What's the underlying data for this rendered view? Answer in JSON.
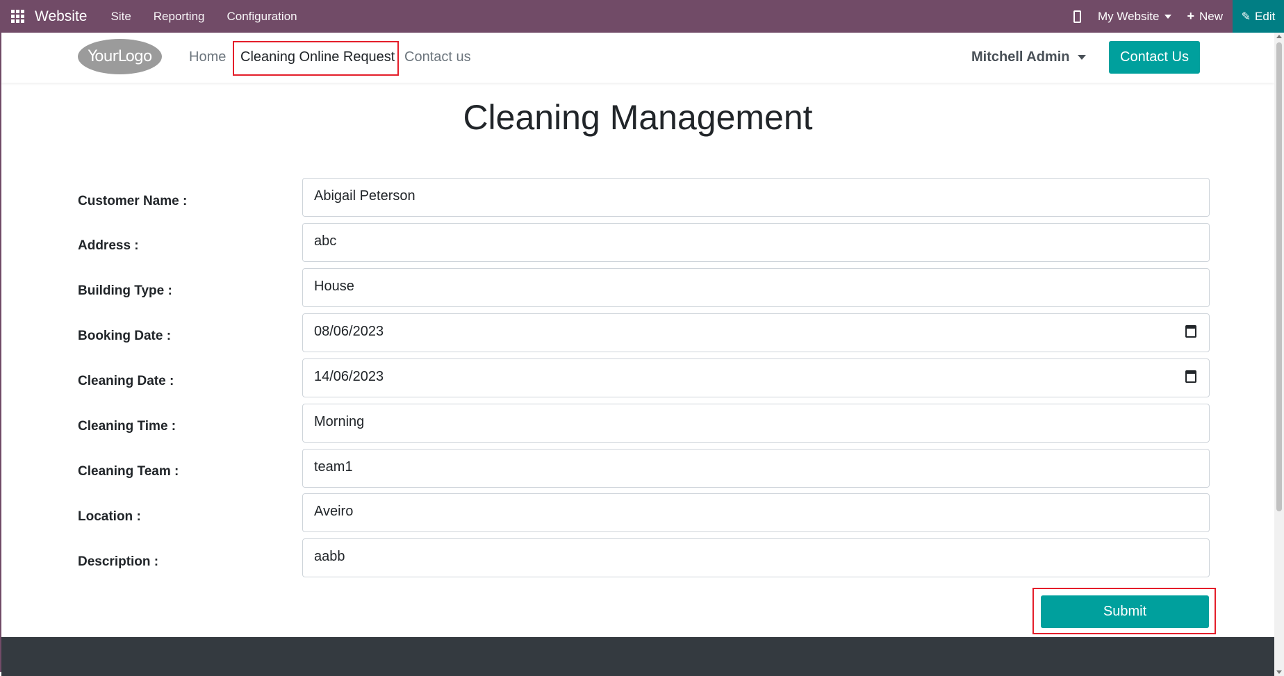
{
  "topbar": {
    "brand": "Website",
    "menu": [
      "Site",
      "Reporting",
      "Configuration"
    ],
    "website_switch": "My Website",
    "new_label": "New",
    "edit_label": "Edit"
  },
  "header": {
    "logo": "YourLogo",
    "nav": [
      "Home",
      "Cleaning Online Request",
      "Contact us"
    ],
    "user": "Mitchell Admin",
    "contact_button": "Contact Us"
  },
  "page": {
    "title": "Cleaning Management"
  },
  "form": {
    "fields": [
      {
        "label": "Customer Name :",
        "value": "Abigail Peterson"
      },
      {
        "label": "Address :",
        "value": "abc"
      },
      {
        "label": "Building Type :",
        "value": "House"
      },
      {
        "label": "Booking Date :",
        "value": "08/06/2023"
      },
      {
        "label": "Cleaning Date :",
        "value": "14/06/2023"
      },
      {
        "label": "Cleaning Time :",
        "value": "Morning"
      },
      {
        "label": "Cleaning Team :",
        "value": "team1"
      },
      {
        "label": "Location :",
        "value": "Aveiro"
      },
      {
        "label": "Description :",
        "value": "aabb"
      }
    ],
    "submit_label": "Submit"
  },
  "colors": {
    "topbar": "#714b67",
    "accent": "#00a09d",
    "highlight": "#e41e2a",
    "footer": "#343a40"
  }
}
